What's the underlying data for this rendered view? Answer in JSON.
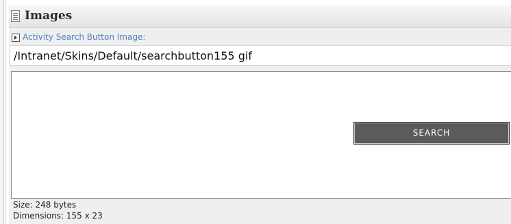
{
  "section": {
    "title": "Images",
    "icon": "document-list-icon"
  },
  "field": {
    "label": "Activity Search Button Image:",
    "toggle_icon": "expand-triangle-icon",
    "value": "/Intranet/Skins/Default/searchbutton155 gif"
  },
  "preview": {
    "button_text": "SEARCH",
    "button_color": "#5b5b5b"
  },
  "info": {
    "size": "Size: 248 bytes",
    "dimensions": "Dimensions: 155 x 23"
  },
  "colors": {
    "label_link": "#4a7fc1",
    "panel_background": "#efefef"
  }
}
